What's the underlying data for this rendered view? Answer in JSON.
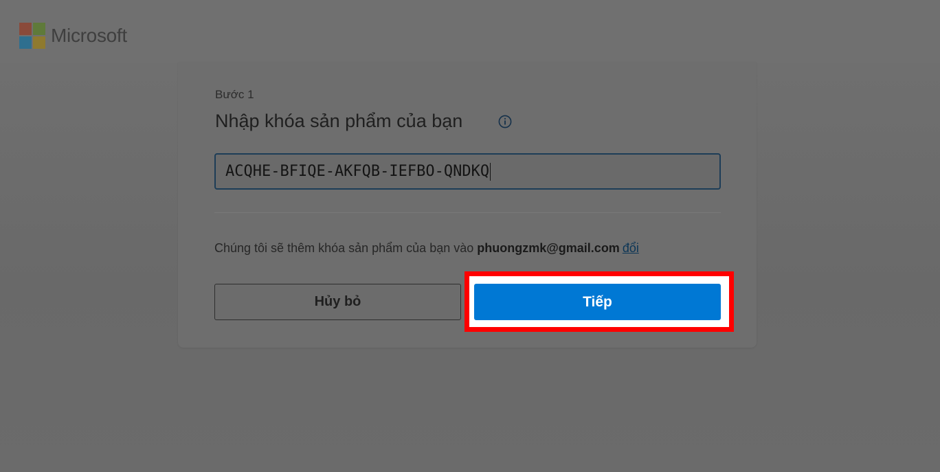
{
  "brand": {
    "name": "Microsoft",
    "logo_colors": [
      "#f25022",
      "#7fba00",
      "#00a4ef",
      "#ffb900"
    ]
  },
  "dialog": {
    "step_label": "Bước 1",
    "title": "Nhập khóa sản phẩm của bạn",
    "info_icon": "info-circle-icon",
    "product_key_value": "ACQHE-BFIQE-AKFQB-IEFBO-QNDKQ",
    "notice_prefix": "Chúng tôi sẽ thêm khóa sản phẩm của bạn vào ",
    "account_email": "phuongzmk@gmail.com",
    "change_link": "đổi",
    "cancel_label": "Hủy bỏ",
    "next_label": "Tiếp"
  },
  "colors": {
    "primary_button": "#0078d4",
    "highlight_border": "#ff0000"
  }
}
